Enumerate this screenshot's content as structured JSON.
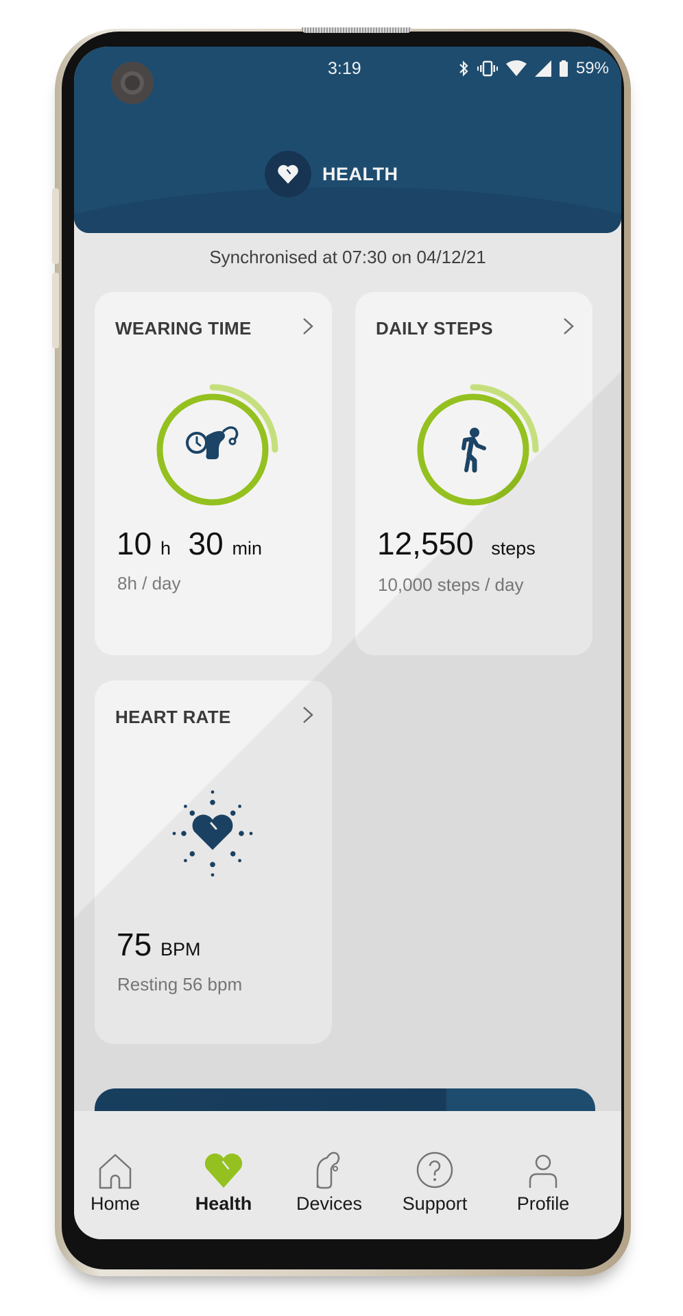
{
  "status_bar": {
    "time": "3:19",
    "icons": [
      "bluetooth-icon",
      "vibrate-icon",
      "wifi-icon",
      "signal-icon",
      "battery-icon"
    ],
    "battery": "59%"
  },
  "header": {
    "title": "HEALTH",
    "icon": "heart-icon",
    "color": "#1e4c6f"
  },
  "sync_text": "Synchronised at 07:30 on 04/12/21",
  "cards": {
    "wearing_time": {
      "title": "WEARING TIME",
      "icon": "hearing-aid-clock-icon",
      "hours": "10",
      "hours_unit": "h",
      "minutes": "30",
      "minutes_unit": "min",
      "goal": "8h / day",
      "progress": 1.3125
    },
    "daily_steps": {
      "title": "DAILY STEPS",
      "icon": "walking-person-icon",
      "value": "12,550",
      "unit": "steps",
      "goal": "10,000 steps / day",
      "progress": 1.255
    },
    "heart_rate": {
      "title": "HEART RATE",
      "icon": "heart-pulse-icon",
      "value": "75",
      "unit": "BPM",
      "resting": "Resting 56 bpm"
    }
  },
  "colors": {
    "accent_green": "#94c11f",
    "accent_green_light": "#c6df7e",
    "icon_navy": "#1b4466"
  },
  "nav": {
    "items": [
      {
        "label": "Home",
        "icon": "home-icon",
        "active": false
      },
      {
        "label": "Health",
        "icon": "heart-icon",
        "active": true
      },
      {
        "label": "Devices",
        "icon": "hearing-aid-icon",
        "active": false
      },
      {
        "label": "Support",
        "icon": "help-circle-icon",
        "active": false
      },
      {
        "label": "Profile",
        "icon": "person-icon",
        "active": false
      }
    ]
  }
}
